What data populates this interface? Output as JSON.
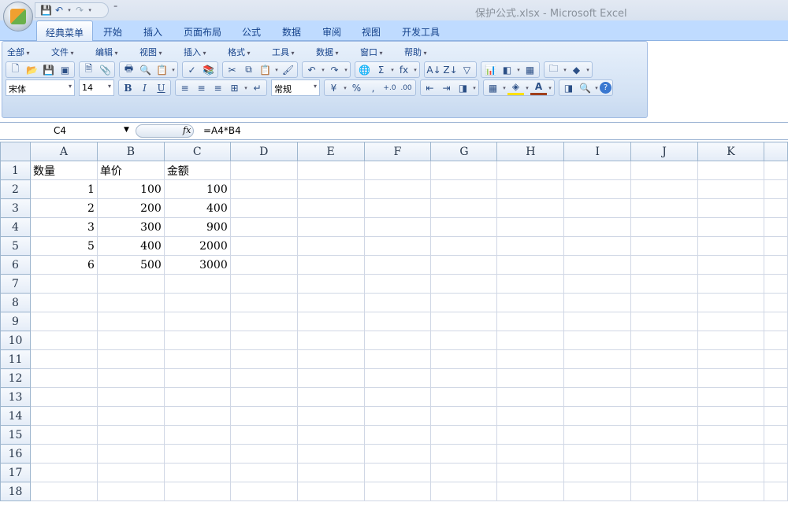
{
  "window": {
    "title": "保护公式.xlsx - Microsoft Excel"
  },
  "qat": {
    "save": "💾",
    "undo": "↶",
    "redo": "↷",
    "more": "⁼"
  },
  "tabs": [
    "经典菜单",
    "开始",
    "插入",
    "页面布局",
    "公式",
    "数据",
    "审阅",
    "视图",
    "开发工具"
  ],
  "menus": [
    "全部",
    "文件",
    "编辑",
    "视图",
    "插入",
    "格式",
    "工具",
    "数据",
    "窗口",
    "帮助"
  ],
  "toolbar1": [
    [
      "new-icon",
      "open-icon",
      "save-icon",
      "permission-icon"
    ],
    [
      "print-preview-icon",
      "attach-icon"
    ],
    [
      "print-icon",
      "preview-icon",
      "paste-special-icon"
    ],
    [
      "spelling-icon",
      "research-icon"
    ],
    [
      "cut-icon",
      "copy-icon",
      "paste-icon",
      "format-painter-icon"
    ],
    [
      "undo-icon",
      "redo-icon"
    ],
    [
      "hyperlink-icon",
      "autosum-icon",
      "function-icon"
    ],
    [
      "sort-asc-icon",
      "sort-desc-icon",
      "filter-icon"
    ],
    [
      "chart-icon",
      "shapes-icon",
      "table-icon"
    ],
    [
      "folder-icon",
      "macro-icon"
    ]
  ],
  "toolbar1_glyphs": {
    "new-icon": "🗋",
    "open-icon": "📂",
    "save-icon": "💾",
    "permission-icon": "▣",
    "print-preview-icon": "🗎",
    "attach-icon": "📎",
    "print-icon": "🖶",
    "preview-icon": "🔍",
    "paste-special-icon": "📋",
    "spelling-icon": "✓",
    "research-icon": "📚",
    "cut-icon": "✂",
    "copy-icon": "⧉",
    "paste-icon": "📋",
    "format-painter-icon": "🖌",
    "undo-icon": "↶",
    "redo-icon": "↷",
    "hyperlink-icon": "🌐",
    "autosum-icon": "Σ",
    "function-icon": "fx",
    "sort-asc-icon": "A↓",
    "sort-desc-icon": "Z↓",
    "filter-icon": "▽",
    "chart-icon": "📊",
    "shapes-icon": "◧",
    "table-icon": "▦",
    "folder-icon": "🗀",
    "macro-icon": "◆"
  },
  "font": {
    "name": "宋体",
    "size": "14",
    "bold": "B",
    "italic": "I",
    "underline": "U"
  },
  "number_format": "常规",
  "toolbar2_glyphs": {
    "align-left": "≡",
    "align-center": "≡",
    "align-right": "≡",
    "merge": "⊞",
    "wrap": "↵",
    "currency": "¥",
    "percent": "%",
    "comma": ",",
    "inc-decimal": "+.0",
    "dec-decimal": ".00",
    "dec-indent": "⇤",
    "inc-indent": "⇥",
    "border": "▦",
    "fill": "◈",
    "font-color": "A",
    "object": "◨",
    "zoom": "🔍",
    "help": "?"
  },
  "formula_bar": {
    "name_box": "C4",
    "fx": "fx",
    "formula": "=A4*B4"
  },
  "columns": [
    "A",
    "B",
    "C",
    "D",
    "E",
    "F",
    "G",
    "H",
    "I",
    "J",
    "K"
  ],
  "rows": [
    "1",
    "2",
    "3",
    "4",
    "5",
    "6",
    "7",
    "8",
    "9",
    "10",
    "11",
    "12",
    "13",
    "14",
    "15",
    "16",
    "17",
    "18"
  ],
  "cells": [
    [
      "数量",
      "单价",
      "金额"
    ],
    [
      "1",
      "100",
      "100"
    ],
    [
      "2",
      "200",
      "400"
    ],
    [
      "3",
      "300",
      "900"
    ],
    [
      "5",
      "400",
      "2000"
    ],
    [
      "6",
      "500",
      "3000"
    ]
  ]
}
